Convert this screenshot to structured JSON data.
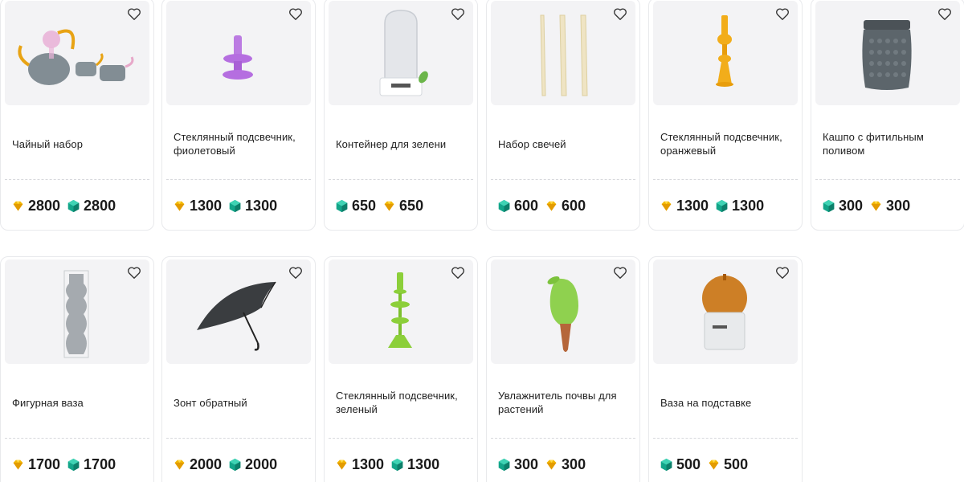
{
  "products": [
    {
      "title": "Чайный набор",
      "prices": [
        {
          "currency": "gold",
          "value": "2800"
        },
        {
          "currency": "teal",
          "value": "2800"
        }
      ],
      "image": "tea-set"
    },
    {
      "title": "Стеклянный подсвечник, фиолетовый",
      "prices": [
        {
          "currency": "gold",
          "value": "1300"
        },
        {
          "currency": "teal",
          "value": "1300"
        }
      ],
      "image": "candlestick-purple"
    },
    {
      "title": "Контейнер для зелени",
      "prices": [
        {
          "currency": "teal",
          "value": "650"
        },
        {
          "currency": "gold",
          "value": "650"
        }
      ],
      "image": "greens-container"
    },
    {
      "title": "Набор свечей",
      "prices": [
        {
          "currency": "teal",
          "value": "600"
        },
        {
          "currency": "gold",
          "value": "600"
        }
      ],
      "image": "candles"
    },
    {
      "title": "Стеклянный подсвечник, оранжевый",
      "prices": [
        {
          "currency": "gold",
          "value": "1300"
        },
        {
          "currency": "teal",
          "value": "1300"
        }
      ],
      "image": "candlestick-orange"
    },
    {
      "title": "Кашпо с фитильным поливом",
      "prices": [
        {
          "currency": "teal",
          "value": "300"
        },
        {
          "currency": "gold",
          "value": "300"
        }
      ],
      "image": "planter"
    },
    {
      "title": "Фигурная ваза",
      "prices": [
        {
          "currency": "gold",
          "value": "1700"
        },
        {
          "currency": "teal",
          "value": "1700"
        }
      ],
      "image": "figure-vase"
    },
    {
      "title": "Зонт обратный",
      "prices": [
        {
          "currency": "gold",
          "value": "2000"
        },
        {
          "currency": "teal",
          "value": "2000"
        }
      ],
      "image": "umbrella"
    },
    {
      "title": "Стеклянный подсвечник, зеленый",
      "prices": [
        {
          "currency": "gold",
          "value": "1300"
        },
        {
          "currency": "teal",
          "value": "1300"
        }
      ],
      "image": "candlestick-green"
    },
    {
      "title": "Увлажнитель почвы для растений",
      "prices": [
        {
          "currency": "teal",
          "value": "300"
        },
        {
          "currency": "gold",
          "value": "300"
        }
      ],
      "image": "soil-humidifier"
    },
    {
      "title": "Ваза на подставке",
      "prices": [
        {
          "currency": "teal",
          "value": "500"
        },
        {
          "currency": "gold",
          "value": "500"
        }
      ],
      "image": "vase-on-stand"
    }
  ],
  "icons": {
    "favorite": "heart-outline-icon",
    "gold_currency": "gold-gem-icon",
    "teal_currency": "teal-gem-icon"
  },
  "colors": {
    "gold": "#f2b705",
    "teal": "#13a589",
    "card_border": "#e8e9ec",
    "thumb_bg": "#f3f3f5"
  }
}
